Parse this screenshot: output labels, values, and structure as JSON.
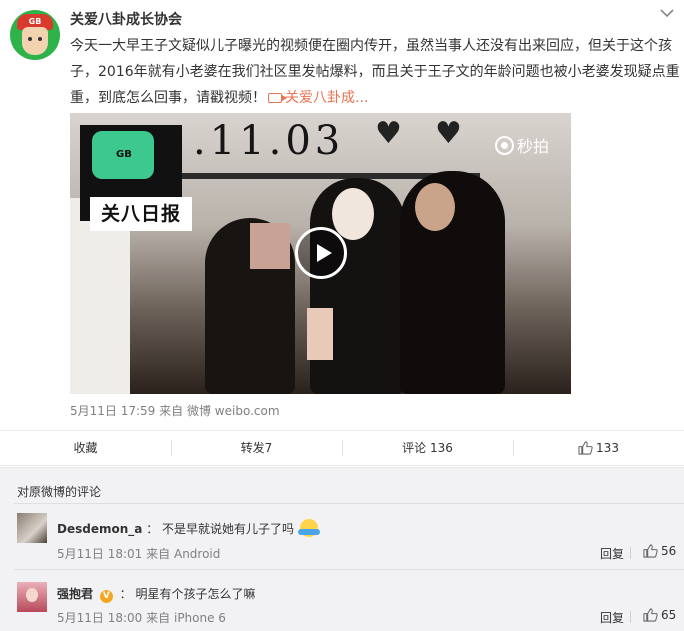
{
  "post": {
    "author": "关爱八卦成长协会",
    "avatar_text": "GB",
    "text_main": "今天一大早王子文疑似儿子曝光的视频便在圈内传开，虽然当事人还没有出来回应，但关于这个孩子，2016年就有小老婆在我们社区里发帖爆料，而且关于王子文的年龄问题也被小老婆发现疑点重重，到底怎么回事，请戳视频！",
    "video_link_label": "关爱八卦成...",
    "video": {
      "date_written": ".11.03",
      "logo_caption": "关八日报",
      "logo_bubble_text": "GB",
      "watermark": "秒拍"
    },
    "timestamp": "5月11日 17:59",
    "source_prefix": "来自",
    "source": "微博 weibo.com"
  },
  "actions": {
    "favorite": "收藏",
    "repost": "转发7",
    "comment": "评论 136",
    "like_count": "133"
  },
  "comments_section": {
    "title": "对原微博的评论",
    "items": [
      {
        "name": "Desdemon_a",
        "separator": "：",
        "text": "不是早就说她有儿子了吗",
        "time": "5月11日 18:01",
        "source_prefix": "来自",
        "source": "Android",
        "reply_label": "回复",
        "likes": "56"
      },
      {
        "name": "强抱君",
        "badge": "V",
        "separator": "：",
        "text": "明星有个孩子怎么了嘛",
        "time": "5月11日 18:00",
        "source_prefix": "来自",
        "source": "iPhone 6",
        "reply_label": "回复",
        "likes": "65"
      }
    ]
  },
  "colors": {
    "link": "#eb7350",
    "muted": "#808080",
    "comments_bg": "#f2f2f5"
  }
}
